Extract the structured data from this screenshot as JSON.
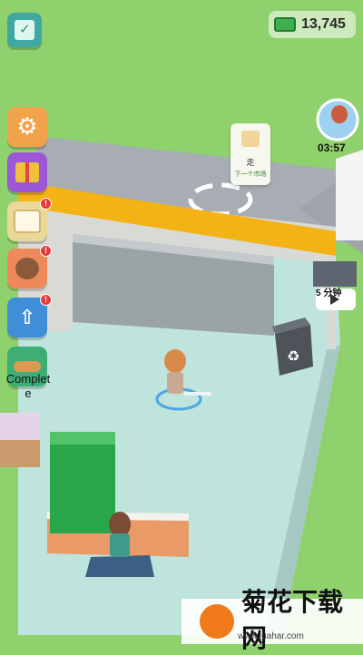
{
  "hud": {
    "money": "13,745",
    "icons": [
      "calendar-check-icon",
      "money-bill-icon"
    ]
  },
  "side_menu": [
    {
      "name": "settings-button",
      "icon": "gear-icon",
      "color": "#f2a24a",
      "badge": false
    },
    {
      "name": "gift-button",
      "icon": "gift-icon",
      "color": "#9b57d6",
      "badge": false
    },
    {
      "name": "orders-button",
      "icon": "bread-order-icon",
      "color": "#e8d89a",
      "badge": true
    },
    {
      "name": "pets-button",
      "icon": "dog-icon",
      "color": "#ee8a5a",
      "badge": true
    },
    {
      "name": "upgrade-button",
      "icon": "upgrade-arrow-icon",
      "color": "#3f8fd8",
      "badge": true
    },
    {
      "name": "complete-button",
      "icon": "bread-loaf-icon",
      "color": "#3fae76",
      "badge": false
    }
  ],
  "complete_label_1": "Complet",
  "complete_label_2": "e",
  "sign": {
    "line1": "走",
    "line2": "下一个市场"
  },
  "customer_timer": "03:57",
  "video_timer": "5 分钟",
  "watermark": {
    "text": "菊花下载网",
    "url": "www.juahar.com"
  },
  "colors": {
    "grass": "#8fd16c",
    "floor": "#bfe3dd",
    "road": "#a9afb3",
    "wall": "#d9d9d4",
    "stripe": "#f3b315",
    "cash_stack": "#2ba84a"
  }
}
